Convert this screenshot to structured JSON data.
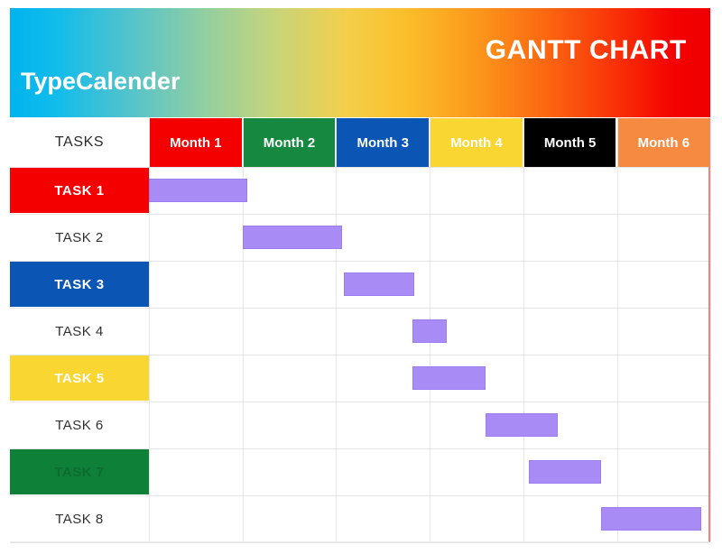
{
  "banner": {
    "title": "GANTT CHART",
    "subtitle": "TypeCalender",
    "gradient_from": "#00b4ee",
    "gradient_to": "#ef0000"
  },
  "table": {
    "tasks_header": "TASKS",
    "months": [
      {
        "label": "Month 1",
        "color": "#f40000",
        "text_color": "#ffffff"
      },
      {
        "label": "Month 2",
        "color": "#16883f",
        "text_color": "#ffffff"
      },
      {
        "label": "Month 3",
        "color": "#0b55b5",
        "text_color": "#ffffff"
      },
      {
        "label": "Month 4",
        "color": "#fad632",
        "text_color": "#ffffff"
      },
      {
        "label": "Month 5",
        "color": "#000000",
        "text_color": "#ffffff"
      },
      {
        "label": "Month 6",
        "color": "#f58a40",
        "text_color": "#ffffff"
      }
    ],
    "rows": [
      {
        "label": "TASK 1",
        "bg": "#f40000",
        "text_color": "#ffffff"
      },
      {
        "label": "TASK 2",
        "bg": "#ffffff",
        "text_color": "#303030"
      },
      {
        "label": "TASK 3",
        "bg": "#0b55b5",
        "text_color": "#ffffff"
      },
      {
        "label": "TASK 4",
        "bg": "#ffffff",
        "text_color": "#303030"
      },
      {
        "label": "TASK 5",
        "bg": "#fad632",
        "text_color": "#ffffff"
      },
      {
        "label": "TASK 6",
        "bg": "#ffffff",
        "text_color": "#303030"
      },
      {
        "label": "TASK 7",
        "bg": "#0e8037",
        "text_color": "#0c6c2f"
      },
      {
        "label": "TASK 8",
        "bg": "#ffffff",
        "text_color": "#303030"
      }
    ]
  },
  "chart_data": {
    "type": "bar",
    "title": "GANTT CHART",
    "subtitle": "TypeCalender",
    "xlabel": "",
    "ylabel": "TASKS",
    "bar_color": "#a98bf5",
    "grid": true,
    "legend": "none",
    "categories": [
      "TASK 1",
      "TASK 2",
      "TASK 3",
      "TASK 4",
      "TASK 5",
      "TASK 6",
      "TASK 7",
      "TASK 8"
    ],
    "x_tick_labels": [
      "Month 1",
      "Month 2",
      "Month 3",
      "Month 4",
      "Month 5",
      "Month 6"
    ],
    "xlim": [
      0,
      6
    ],
    "bars": [
      {
        "task": "TASK 1",
        "start_month": 0.0,
        "end_month": 1.05,
        "duration_months": 1.05
      },
      {
        "task": "TASK 2",
        "start_month": 1.0,
        "end_month": 2.06,
        "duration_months": 1.06
      },
      {
        "task": "TASK 3",
        "start_month": 2.08,
        "end_month": 2.84,
        "duration_months": 0.76
      },
      {
        "task": "TASK 4",
        "start_month": 2.82,
        "end_month": 3.18,
        "duration_months": 0.36
      },
      {
        "task": "TASK 5",
        "start_month": 2.82,
        "end_month": 3.6,
        "duration_months": 0.78
      },
      {
        "task": "TASK 6",
        "start_month": 3.6,
        "end_month": 4.37,
        "duration_months": 0.77
      },
      {
        "task": "TASK 7",
        "start_month": 4.06,
        "end_month": 4.83,
        "duration_months": 0.77
      },
      {
        "task": "TASK 8",
        "start_month": 4.83,
        "end_month": 5.9,
        "duration_months": 1.07
      }
    ]
  }
}
